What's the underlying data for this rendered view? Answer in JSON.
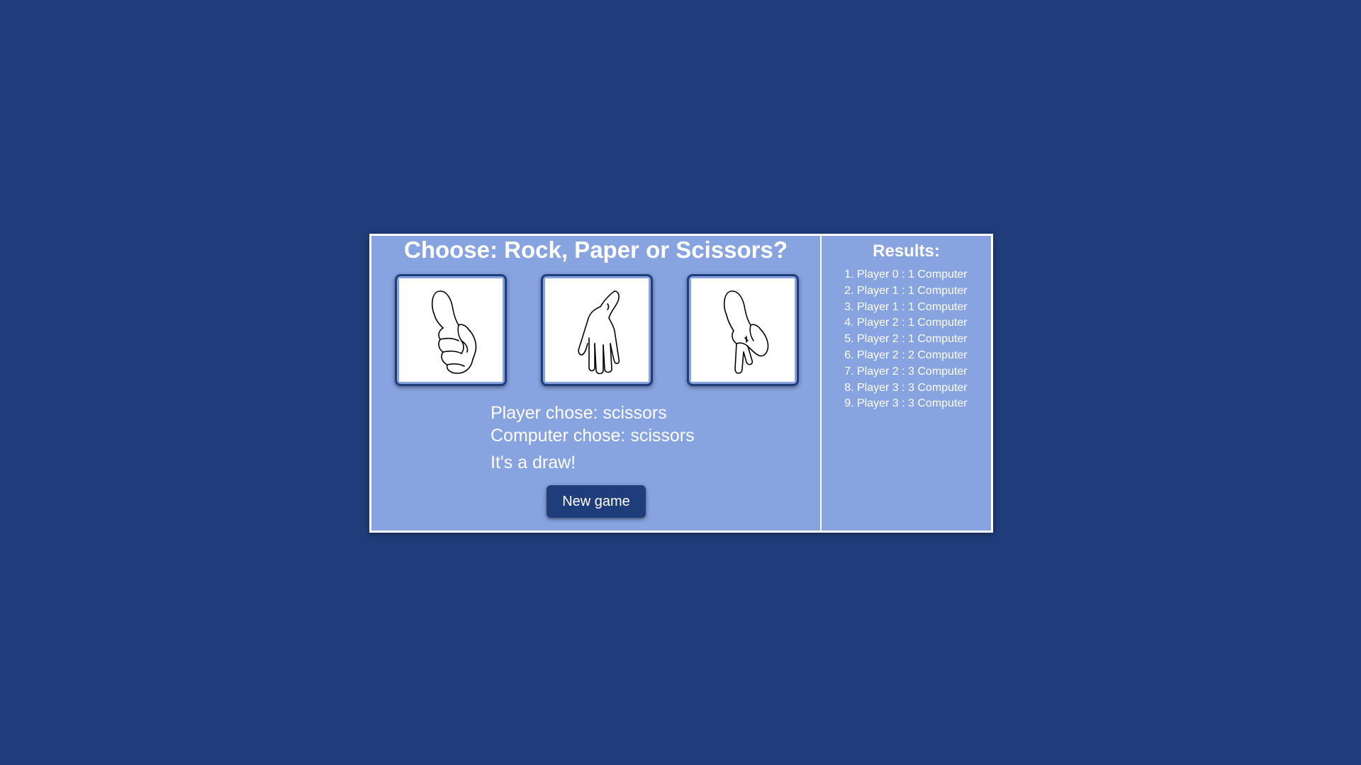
{
  "game": {
    "title": "Choose: Rock, Paper or Scissors?",
    "choices": [
      {
        "name": "rock",
        "icon": "rock-hand-icon"
      },
      {
        "name": "paper",
        "icon": "paper-hand-icon"
      },
      {
        "name": "scissors",
        "icon": "scissors-hand-icon"
      }
    ],
    "player_choice": "Player chose: scissors",
    "computer_choice": "Computer chose: scissors",
    "outcome": "It's a draw!",
    "new_game_label": "New game"
  },
  "results": {
    "title": "Results:",
    "items": [
      "Player 0 : 1 Computer",
      "Player 1 : 1 Computer",
      "Player 1 : 1 Computer",
      "Player 2 : 1 Computer",
      "Player 2 : 1 Computer",
      "Player 2 : 2 Computer",
      "Player 2 : 3 Computer",
      "Player 3 : 3 Computer",
      "Player 3 : 3 Computer"
    ]
  },
  "colors": {
    "background": "#1f3d7b",
    "panel": "#87a3e0",
    "border": "#ffffff",
    "button": "#1f3d7b"
  }
}
